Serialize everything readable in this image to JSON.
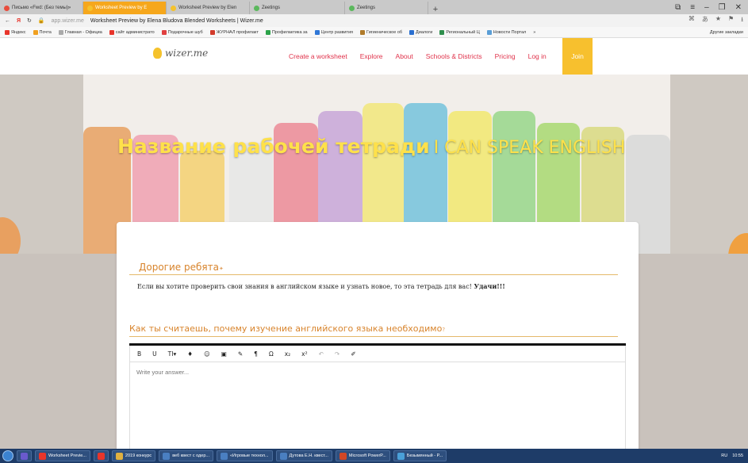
{
  "browser": {
    "tabs": [
      {
        "label": "Письмо «Fwd: (Без темы)»",
        "color": "#e84d3d",
        "active": false
      },
      {
        "label": "Worksheet Preview by E",
        "color": "#f5c22c",
        "active": true
      },
      {
        "label": "Worksheet Preview by Elen",
        "color": "#f5c22c",
        "active": false
      },
      {
        "label": "Zeetings",
        "color": "#5bb85d",
        "active": false
      },
      {
        "label": "Zeetings",
        "color": "#5bb85d",
        "active": false
      }
    ],
    "new_tab_label": "+",
    "address": {
      "domain": "app.wizer.me",
      "title": "Worksheet Preview by Elena Bludova Blended Worksheets | Wizer.me"
    },
    "bookmarks": [
      {
        "label": "Яндекс",
        "color": "#e8352b"
      },
      {
        "label": "Почта",
        "color": "#f0a020"
      },
      {
        "label": "Главная - Официа",
        "color": "#aaaaaa"
      },
      {
        "label": "сайт администрато",
        "color": "#e8352b"
      },
      {
        "label": "Подарочные шуб",
        "color": "#e04040"
      },
      {
        "label": "ЖУРНАЛ профилакт",
        "color": "#d23b2b"
      },
      {
        "label": "Профилактика за",
        "color": "#2ca34a"
      },
      {
        "label": "Центр развития",
        "color": "#3077d6"
      },
      {
        "label": "Гигиеническое об",
        "color": "#b07b2a"
      },
      {
        "label": "Диалоги",
        "color": "#2a6fd0"
      },
      {
        "label": "Региональный Ц",
        "color": "#2f8f4d"
      },
      {
        "label": "Новости Портал",
        "color": "#5a9ed6"
      }
    ],
    "bookmarks_more": "»",
    "other_bookmarks": "Другие закладки"
  },
  "site": {
    "logo_text": "wizer.me",
    "nav": [
      "Create a worksheet",
      "Explore",
      "About",
      "Schools & Districts",
      "Pricing",
      "Log in"
    ],
    "join_label": "Join",
    "accent_color": "#e0334b",
    "join_color": "#f7c02e"
  },
  "hero": {
    "title_main": "Название рабочей тетради",
    "title_sub": "I CAN SPEAK ENGLISH",
    "title_color": "#ffe14a"
  },
  "worksheet": {
    "intro_heading": "Дорогие ребята",
    "intro_text": "Если вы хотите проверить свои знания в английском языке и узнать новое, то эта тетрадь для вас!",
    "intro_bold": "Удачи!!!",
    "question": "Как ты считаешь, почему изучение английского языка необходимо",
    "answer_placeholder": "Write your answer...",
    "toolbar": [
      "B",
      "U",
      "TI▾",
      "♦",
      "☺",
      "▣",
      "✎",
      "¶",
      "Ω",
      "x₂",
      "x²",
      "↶",
      "↷",
      "✐"
    ]
  },
  "taskbar": {
    "items": [
      {
        "label": "",
        "color": "#6a5acd"
      },
      {
        "label": "Worksheet Previe...",
        "color": "#e8352b"
      },
      {
        "label": "",
        "color": "#e8352b"
      },
      {
        "label": "2019 конкурс",
        "color": "#e0b040"
      },
      {
        "label": "веб квест с одер...",
        "color": "#4a7fc1"
      },
      {
        "label": "«Игровые технол...",
        "color": "#4a7fc1"
      },
      {
        "label": "Дутова Е.Н. квест...",
        "color": "#4a7fc1"
      },
      {
        "label": "Microsoft PowerP...",
        "color": "#d24726"
      },
      {
        "label": "Безымянный - P...",
        "color": "#4aa0d8"
      }
    ],
    "language": "RU",
    "time": "10:55"
  }
}
